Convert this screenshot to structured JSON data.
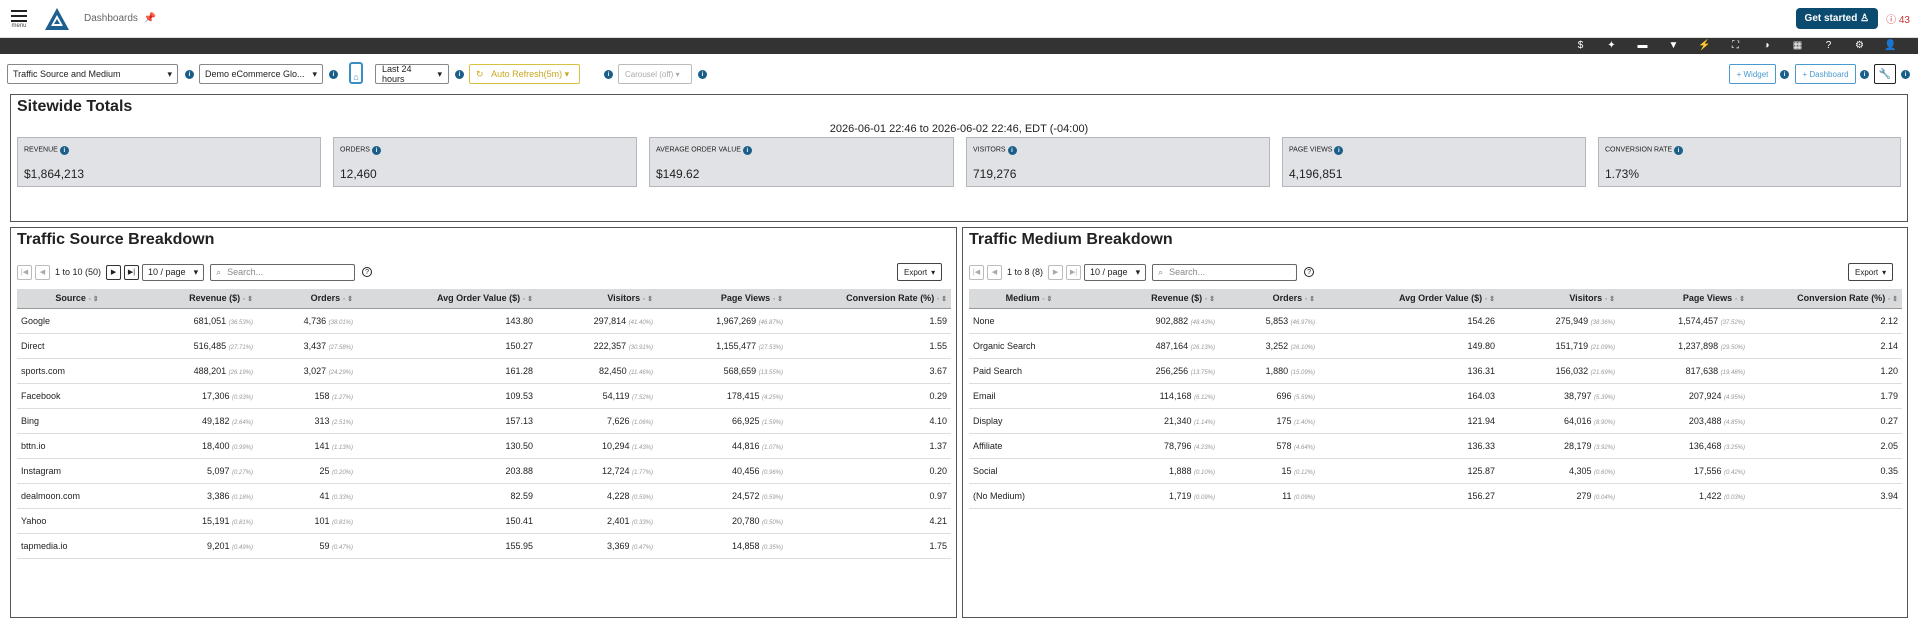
{
  "header": {
    "menu_label": "menu",
    "breadcrumb": "Dashboards",
    "get_started": "Get started",
    "alert_count": "43"
  },
  "iconbar": [
    "$",
    "✦",
    "▬",
    "▼",
    "⚡",
    "⛶",
    "◑",
    "▦",
    "?",
    "⚙",
    "👤"
  ],
  "controls": {
    "report": "Traffic Source and Medium",
    "site": "Demo eCommerce Glo...",
    "range": "Last 24 hours",
    "refresh": "Auto Refresh(5m)",
    "carousel": "Carousel (off)",
    "add_widget": "+ Widget",
    "add_dashboard": "+ Dashboard"
  },
  "sitewide": {
    "title": "Sitewide Totals",
    "daterange": "2026-06-01 22:46 to 2026-06-02 22:46, EDT (-04:00)",
    "kpis": [
      {
        "label": "REVENUE",
        "value": "$1,864,213"
      },
      {
        "label": "ORDERS",
        "value": "12,460"
      },
      {
        "label": "AVERAGE ORDER VALUE",
        "value": "$149.62"
      },
      {
        "label": "VISITORS",
        "value": "719,276"
      },
      {
        "label": "PAGE VIEWS",
        "value": "4,196,851"
      },
      {
        "label": "CONVERSION RATE",
        "value": "1.73%"
      }
    ]
  },
  "source": {
    "title": "Traffic Source Breakdown",
    "paging": "1 to 10 (50)",
    "perpage": "10 / page",
    "search_placeholder": "Search...",
    "export": "Export",
    "columns": [
      "Source",
      "Revenue ($)",
      "Orders",
      "Avg Order Value ($)",
      "Visitors",
      "Page Views",
      "Conversion Rate (%)"
    ],
    "rows": [
      [
        "Google",
        "681,051",
        "(36.53%)",
        "4,736",
        "(38.01%)",
        "143.80",
        "297,814",
        "(41.40%)",
        "1,967,269",
        "(46.87%)",
        "1.59"
      ],
      [
        "Direct",
        "516,485",
        "(27.71%)",
        "3,437",
        "(27.58%)",
        "150.27",
        "222,357",
        "(30.91%)",
        "1,155,477",
        "(27.53%)",
        "1.55"
      ],
      [
        "sports.com",
        "488,201",
        "(26.19%)",
        "3,027",
        "(24.29%)",
        "161.28",
        "82,450",
        "(11.46%)",
        "568,659",
        "(13.55%)",
        "3.67"
      ],
      [
        "Facebook",
        "17,306",
        "(0.93%)",
        "158",
        "(1.27%)",
        "109.53",
        "54,119",
        "(7.52%)",
        "178,415",
        "(4.25%)",
        "0.29"
      ],
      [
        "Bing",
        "49,182",
        "(2.64%)",
        "313",
        "(2.51%)",
        "157.13",
        "7,626",
        "(1.06%)",
        "66,925",
        "(1.59%)",
        "4.10"
      ],
      [
        "bttn.io",
        "18,400",
        "(0.99%)",
        "141",
        "(1.13%)",
        "130.50",
        "10,294",
        "(1.43%)",
        "44,816",
        "(1.07%)",
        "1.37"
      ],
      [
        "Instagram",
        "5,097",
        "(0.27%)",
        "25",
        "(0.20%)",
        "203.88",
        "12,724",
        "(1.77%)",
        "40,456",
        "(0.96%)",
        "0.20"
      ],
      [
        "dealmoon.com",
        "3,386",
        "(0.18%)",
        "41",
        "(0.33%)",
        "82.59",
        "4,228",
        "(0.59%)",
        "24,572",
        "(0.59%)",
        "0.97"
      ],
      [
        "Yahoo",
        "15,191",
        "(0.81%)",
        "101",
        "(0.81%)",
        "150.41",
        "2,401",
        "(0.33%)",
        "20,780",
        "(0.50%)",
        "4.21"
      ],
      [
        "tapmedia.io",
        "9,201",
        "(0.49%)",
        "59",
        "(0.47%)",
        "155.95",
        "3,369",
        "(0.47%)",
        "14,858",
        "(0.35%)",
        "1.75"
      ]
    ]
  },
  "medium": {
    "title": "Traffic Medium Breakdown",
    "paging": "1 to 8 (8)",
    "perpage": "10 / page",
    "search_placeholder": "Search...",
    "export": "Export",
    "columns": [
      "Medium",
      "Revenue ($)",
      "Orders",
      "Avg Order Value ($)",
      "Visitors",
      "Page Views",
      "Conversion Rate (%)"
    ],
    "rows": [
      [
        "None",
        "902,882",
        "(48.43%)",
        "5,853",
        "(46.97%)",
        "154.26",
        "275,949",
        "(38.36%)",
        "1,574,457",
        "(37.52%)",
        "2.12"
      ],
      [
        "Organic Search",
        "487,164",
        "(26.13%)",
        "3,252",
        "(26.10%)",
        "149.80",
        "151,719",
        "(21.09%)",
        "1,237,898",
        "(29.50%)",
        "2.14"
      ],
      [
        "Paid Search",
        "256,256",
        "(13.75%)",
        "1,880",
        "(15.09%)",
        "136.31",
        "156,032",
        "(21.69%)",
        "817,638",
        "(19.48%)",
        "1.20"
      ],
      [
        "Email",
        "114,168",
        "(6.12%)",
        "696",
        "(5.59%)",
        "164.03",
        "38,797",
        "(5.39%)",
        "207,924",
        "(4.95%)",
        "1.79"
      ],
      [
        "Display",
        "21,340",
        "(1.14%)",
        "175",
        "(1.40%)",
        "121.94",
        "64,016",
        "(8.90%)",
        "203,488",
        "(4.85%)",
        "0.27"
      ],
      [
        "Affiliate",
        "78,796",
        "(4.23%)",
        "578",
        "(4.64%)",
        "136.33",
        "28,179",
        "(3.92%)",
        "136,468",
        "(3.25%)",
        "2.05"
      ],
      [
        "Social",
        "1,888",
        "(0.10%)",
        "15",
        "(0.12%)",
        "125.87",
        "4,305",
        "(0.60%)",
        "17,556",
        "(0.42%)",
        "0.35"
      ],
      [
        "(No Medium)",
        "1,719",
        "(0.09%)",
        "11",
        "(0.09%)",
        "156.27",
        "279",
        "(0.04%)",
        "1,422",
        "(0.03%)",
        "3.94"
      ]
    ]
  }
}
